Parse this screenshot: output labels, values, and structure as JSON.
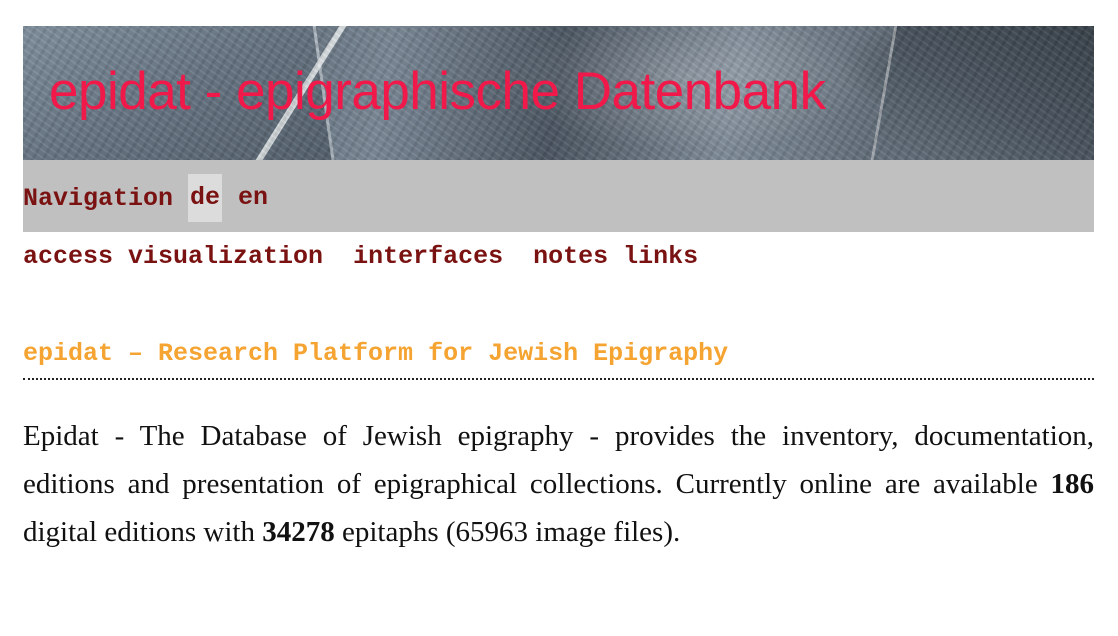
{
  "banner": {
    "title": "epidat - epigraphische Datenbank"
  },
  "language_bar": {
    "label": "Navigation",
    "languages": [
      {
        "code": "de",
        "active": true
      },
      {
        "code": "en",
        "active": false
      }
    ]
  },
  "menu": {
    "items": [
      "access",
      "visualization",
      "interfaces",
      "notes",
      "links"
    ]
  },
  "section": {
    "heading": "epidat – Research Platform for Jewish Epigraphy"
  },
  "intro": {
    "part1": "Epidat - The Database of Jewish epigraphy - provides the inventory, documentation, editions and presentation of epigraphical collections. Currently online are available ",
    "editions_count": "186",
    "part2": " digital editions with ",
    "epitaphs_count": "34278",
    "part3": " epitaphs (65963 image files)."
  },
  "colors": {
    "banner_title": "#f0194a",
    "nav_text": "#7a1212",
    "nav_bar_bg": "#c0c0c0",
    "active_lang_bg": "#dcdcdc",
    "section_heading": "#f5a331"
  }
}
